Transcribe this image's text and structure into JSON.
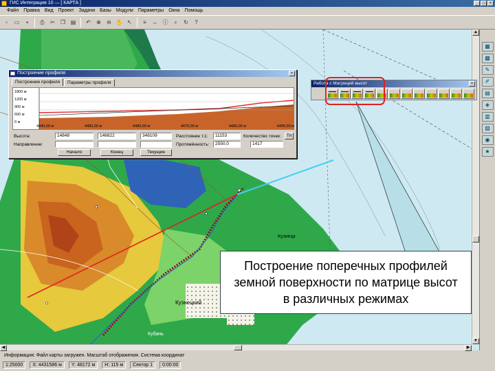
{
  "window": {
    "title": "ГИС Интеграция 10 — [ КАРТА ]",
    "controls": [
      "_",
      "□",
      "×"
    ]
  },
  "menu": [
    "Файл",
    "Правка",
    "Вид",
    "Проект",
    "Задачи",
    "Базы",
    "Модули",
    "Параметры",
    "Окна",
    "Помощь"
  ],
  "toolbar_icons": [
    "new-icon",
    "open-icon",
    "save-icon",
    "print-icon",
    "cut-icon",
    "copy-icon",
    "paste-icon",
    "undo-icon",
    "zoom-in-icon",
    "zoom-out-icon",
    "hand-icon",
    "select-icon",
    "layers-icon",
    "measure-icon",
    "info-icon",
    "search-icon",
    "refresh-icon",
    "help-icon"
  ],
  "profile_dialog": {
    "title": "Построение профиля",
    "close": "×",
    "tabs": [
      "Построение профиля",
      "Параметры профиля"
    ],
    "y_ticks": [
      "1800 м",
      "1200 м",
      "900 м",
      "600 м",
      "0 м"
    ],
    "x_ticks": [
      "4440,00 м",
      "4460,00 м",
      "4480,00 м",
      "4470,00 м",
      "4480,00 м",
      "4490,00 м"
    ],
    "fields": {
      "start_label": "Высота:",
      "start_value": "14848",
      "mid_value": "146822",
      "end_value": "348109",
      "step_label": "Расстояние т.1:",
      "step_value": "11153",
      "dist_label": "Протяжённость:",
      "dist_value": "2550,0",
      "point_label": "Количество точек:",
      "count_value": "1417",
      "row2_label": "Направление:",
      "btn_start": "Начало",
      "btn_end": "Конец",
      "btn_current": "Текущие",
      "btn_side": "Тп"
    }
  },
  "matrix_toolbar": {
    "title": "Работа с Матрицей высот",
    "button_count": 12
  },
  "callout": {
    "text": "Построение поперечных профилей земной поверхности по матрице высот в различных режимах"
  },
  "map_labels": {
    "village": "Кузнецк",
    "river": "Кубань",
    "place2": "Кузнецкий"
  },
  "status": {
    "line1": "Информация: Файл карты загружен. Масштаб отображения. Система координат",
    "cells": [
      "1:25000",
      "X: 4431586 м",
      "Y: 48172 м",
      "H: 115 м",
      "Сектор 1",
      "0:00:00"
    ]
  },
  "colors": {
    "accent": "#0a246a",
    "highlight": "#e02020",
    "profile_line": "#e03030",
    "transect": "#e02020",
    "cyan_line": "#40d0f0"
  }
}
